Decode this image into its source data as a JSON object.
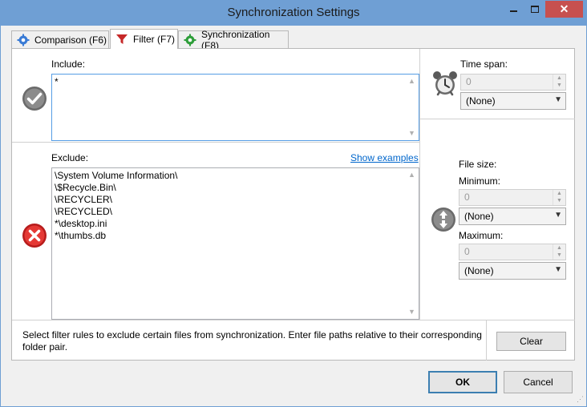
{
  "window": {
    "title": "Synchronization Settings",
    "controls": {
      "minimize": "minimize-icon",
      "maximize": "maximize-icon",
      "close": "close-icon"
    }
  },
  "tabs": [
    {
      "label": "Comparison (F6)",
      "icon": "gear-icon",
      "active": false
    },
    {
      "label": "Filter (F7)",
      "icon": "filter-icon",
      "active": true
    },
    {
      "label": "Synchronization (F8)",
      "icon": "sync-gear-icon",
      "active": false
    }
  ],
  "include": {
    "label": "Include:",
    "value": "*",
    "icon": "checkmark-icon"
  },
  "exclude": {
    "label": "Exclude:",
    "show_examples": "Show examples",
    "lines": [
      "\\System Volume Information\\",
      "\\$Recycle.Bin\\",
      "\\RECYCLER\\",
      "\\RECYCLED\\",
      "*\\desktop.ini",
      "*\\thumbs.db"
    ],
    "icon": "cross-icon"
  },
  "time_span": {
    "label": "Time span:",
    "value": "0",
    "unit": "(None)",
    "icon": "alarm-clock-icon"
  },
  "file_size": {
    "label": "File size:",
    "minimum_label": "Minimum:",
    "minimum_value": "0",
    "minimum_unit": "(None)",
    "maximum_label": "Maximum:",
    "maximum_value": "0",
    "maximum_unit": "(None)",
    "icon": "size-arrows-icon"
  },
  "footer": {
    "help": "Select filter rules to exclude certain files from synchronization. Enter file paths relative to their corresponding folder pair.",
    "clear": "Clear"
  },
  "dialog_buttons": {
    "ok": "OK",
    "cancel": "Cancel"
  }
}
